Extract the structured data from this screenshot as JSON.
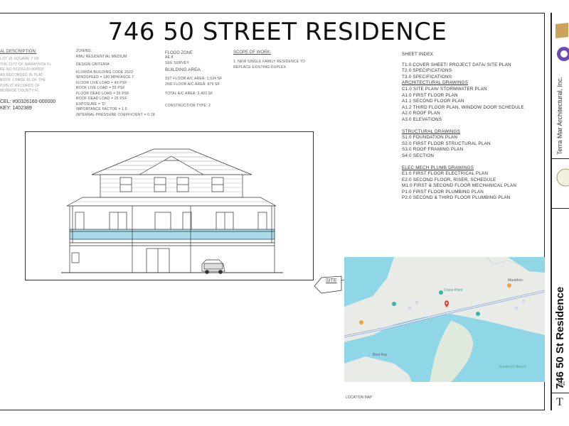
{
  "title": "746 50 STREET RESIDENCE",
  "legal": {
    "heading": "AL DESCRIPTION:",
    "lines": [
      "LOT 15 SQUARE 7 OF",
      "THE CITY OF MARATHON FL",
      "RE NO 00326160-000000",
      "AS RECORDED IN PLAT",
      "BOOK 1 PAGE 65 OF THE",
      "PUBLIC RECORDS OF",
      "MONROE COUNTY FL"
    ],
    "parcel": "CEL: #00326160-000000",
    "key": "KEY: 1402389"
  },
  "zoning": {
    "heading": "ZONING:",
    "value": "RMU RESIDENTIAL MEDIUM",
    "criteria_heading": "DESIGN CRITERIA",
    "criteria": [
      "FLORIDA BUILDING CODE 2023",
      "WINDSPEED = 180 MPH/ASCE 7",
      "FLOOR LIVE LOAD = 40 PSF",
      "ROOF LIVE LOAD = 55 PSF",
      "FLOOR DEAD LOAD = 25 PSF",
      "ROOF DEAD LOAD = 25 PSF",
      "EXPOSURE = 'D'",
      "IMPORTANCE FACTOR = 1.0",
      "INTERNAL PRESSURE COEFFICIENT = 0.18"
    ]
  },
  "flood": {
    "heading": "FLOOD ZONE",
    "lines": [
      "AE 8",
      "SEE SURVEY"
    ],
    "area_heading": "BUILDING AREA",
    "areas": [
      "1ST FLOOR A/C AREA: 1,524 SF",
      "2ND FLOOR A/C AREA: 879 SF"
    ],
    "total": "TOTAL A/C AREA: 2,403 SF",
    "construction": "CONSTRUCTION TYPE: 2"
  },
  "scope": {
    "heading": "SCOPE OF WORK:",
    "lines": [
      "1. NEW SINGLE FAMILY RESIDENCE TO",
      "REPLACE EXISTING DUPLEX"
    ]
  },
  "sheet_index": {
    "heading": "SHEET INDEX",
    "groups": [
      {
        "title": "",
        "items": [
          "T1.0 COVER SHEET/ PROJECT DATA/ SITE PLAN",
          "T2.0 SPECIFICATIONS",
          "T3.0 SPECIFICATIONS"
        ]
      },
      {
        "title": "ARCHITECTURAL DRAWINGS",
        "items": [
          "C1.0 SITE PLAN/ STORMWATER PLAN",
          "A1.0 FIRST FLOOR PLAN",
          "A1.1 SECOND FLOOR PLAN",
          "A1.2 THIRD FLOOR PLAN, WINDOW DOOR SCHEDULE",
          "A2.0 ROOF PLAN",
          "A3.0 ELEVATIONS"
        ]
      },
      {
        "title": "STRUCTURAL DRAWINGS",
        "items": [
          "S1.0 FOUNDATION PLAN",
          "S2.0 FIRST FLOOR STRUCTURAL PLAN",
          "S3.0 ROOF FRAMING PLAN",
          "S4.0 SECTION"
        ]
      },
      {
        "title": "ELEC MECH PLUMB DRAWINGS",
        "items": [
          "E1.0 FIRST FLOOR ELECTRICAL PLAN",
          "E2.0 SECOND FLOOR, RISER, SCHEDULE",
          "M1.0 FIRST & SECOND FLOOR MECHANICAL PLAN",
          "P1.0 FIRST FLOOR PLUMBING PLAN",
          "P2.0 SECOND & THIRD FLOOR PLUMBING PLAN"
        ]
      }
    ]
  },
  "map": {
    "site_label": "SITE",
    "caption": "LOCATION MAP",
    "places": [
      "Sombrero Beach",
      "Crane Point",
      "Marathon",
      "Boot Key"
    ]
  },
  "title_block": {
    "firm": "Terra Mar Architectural, Inc.",
    "project": "746 50 St Residence",
    "sheet_label": "SH",
    "sheet_no": "T"
  },
  "colors": {
    "water": "#8fd6e6",
    "land": "#e8ebe6",
    "railing": "#a7dbe9",
    "ink": "#222222"
  }
}
